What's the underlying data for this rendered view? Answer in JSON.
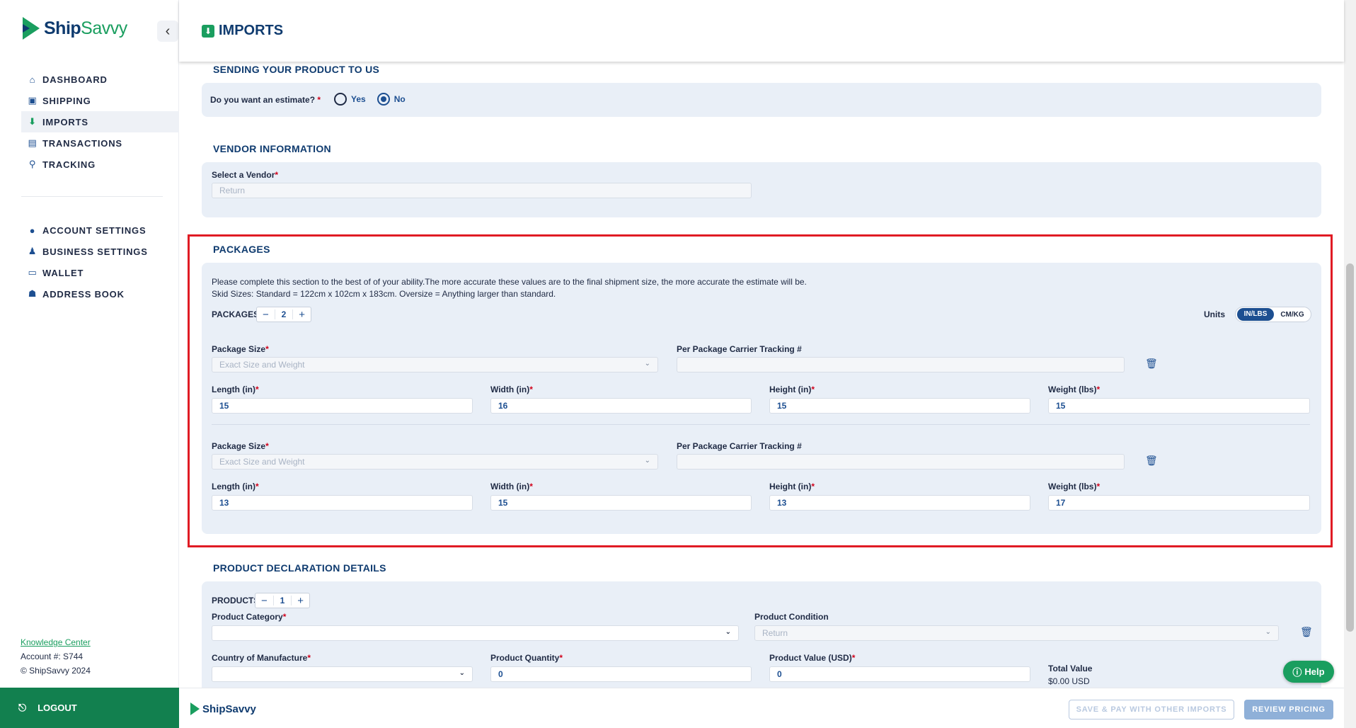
{
  "brand": {
    "name_a": "Ship",
    "name_b": "Savvy"
  },
  "header": {
    "title": "IMPORTS"
  },
  "sidebar": {
    "items": [
      {
        "label": "DASHBOARD",
        "icon": "home-icon"
      },
      {
        "label": "SHIPPING",
        "icon": "box-icon"
      },
      {
        "label": "IMPORTS",
        "icon": "imports-icon",
        "active": true
      },
      {
        "label": "TRANSACTIONS",
        "icon": "document-icon"
      },
      {
        "label": "TRACKING",
        "icon": "tracking-icon"
      }
    ],
    "items2": [
      {
        "label": "ACCOUNT SETTINGS",
        "icon": "user-icon"
      },
      {
        "label": "BUSINESS SETTINGS",
        "icon": "business-icon"
      },
      {
        "label": "WALLET",
        "icon": "wallet-icon"
      },
      {
        "label": "ADDRESS BOOK",
        "icon": "address-book-icon"
      }
    ],
    "knowledge": "Knowledge Center",
    "account": "Account #: S744",
    "copyright": "© ShipSavvy 2024",
    "logout": "LOGOUT"
  },
  "sending": {
    "title": "SENDING YOUR PRODUCT TO US",
    "question": "Do you want an estimate?",
    "req": "*",
    "yes": "Yes",
    "no": "No"
  },
  "vendor": {
    "title": "VENDOR INFORMATION",
    "label": "Select a Vendor",
    "value": "Return"
  },
  "packages": {
    "title": "PACKAGES",
    "note1": "Please complete this section to the best of of your ability.The more accurate these values are to the final shipment size, the more accurate the estimate will be.",
    "note2": "Skid Sizes: Standard = 122cm x 102cm x 183cm. Oversize = Anything larger than standard.",
    "count_label": "PACKAGES",
    "count": "2",
    "units_label": "Units",
    "units_a": "IN/LBS",
    "units_b": "CM/KG",
    "size_label": "Package Size",
    "tracking_label": "Per Package Carrier Tracking #",
    "size_placeholder": "Exact Size and Weight",
    "length_label": "Length (in)",
    "width_label": "Width (in)",
    "height_label": "Height (in)",
    "weight_label": "Weight (lbs)",
    "list": [
      {
        "length": "15",
        "width": "16",
        "height": "15",
        "weight": "15"
      },
      {
        "length": "13",
        "width": "15",
        "height": "13",
        "weight": "17"
      }
    ]
  },
  "products": {
    "title": "PRODUCT DECLARATION DETAILS",
    "count_label": "PRODUCTS",
    "count": "1",
    "category_label": "Product Category",
    "condition_label": "Product Condition",
    "condition_value": "Return",
    "country_label": "Country of Manufacture",
    "quantity_label": "Product Quantity",
    "quantity": "0",
    "value_label": "Product Value (USD)",
    "value": "0",
    "total_label": "Total Value",
    "total": "$0.00 USD"
  },
  "footer": {
    "save": "SAVE & PAY WITH OTHER IMPORTS",
    "review": "REVIEW PRICING",
    "help": "Help"
  },
  "colors": {
    "brand_green": "#1a9e5f",
    "brand_navy": "#0f3b6f",
    "highlight": "#e01b24"
  }
}
